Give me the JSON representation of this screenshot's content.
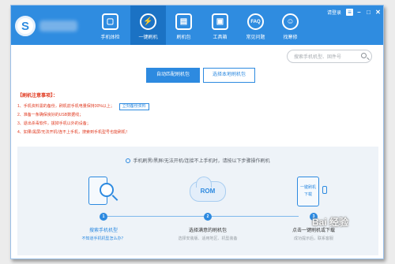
{
  "window": {
    "user_label": "请登录",
    "accent": "#2f8ce0",
    "controls": [
      "menu-icon",
      "minimize-icon",
      "maximize-icon",
      "close-icon"
    ]
  },
  "nav": [
    {
      "label": "手机体检",
      "icon": "phone-check-icon",
      "glyph": "▢"
    },
    {
      "label": "一键刷机",
      "icon": "flash-icon",
      "glyph": "⚡"
    },
    {
      "label": "刷机包",
      "icon": "package-icon",
      "glyph": "▤"
    },
    {
      "label": "工具箱",
      "icon": "toolbox-icon",
      "glyph": "▣"
    },
    {
      "label": "常见问题",
      "icon": "faq-icon",
      "glyph": "FAQ"
    },
    {
      "label": "找寒修",
      "icon": "repair-person-icon",
      "glyph": "☺"
    }
  ],
  "search": {
    "placeholder": "搜索手机机型、固件号"
  },
  "actions": {
    "auto_match": "自动匹配刷机包",
    "local_package": "选择本地刷机包"
  },
  "notes": {
    "title": "【刷机注意事项】：",
    "items": [
      "1、手机资料需的备份，刷机前手机电量保持30%以上；",
      "2、准备一条确保良好的USB数据线；",
      "3、退出杀毒软件，拔掉手机以外的设备；",
      "4、如果/黑屏/无法开机/连不上手机，搜索到手机型号也能刷机！"
    ],
    "backup_button": "立刻备份资料"
  },
  "guide": {
    "hint": "手机刷黑/黑屏/无法开机/连接不上手机时，请按以下步骤操作刷机",
    "steps": [
      {
        "num": "1",
        "title": "搜索手机机型",
        "sub": "不知道手机机型怎么办？",
        "icon": "phone-search-icon"
      },
      {
        "num": "2",
        "title": "选择满意的刷机包",
        "sub": "选择安装版、适用地区、机型装备",
        "icon": "rom-cloud-icon",
        "rom": "ROM"
      },
      {
        "num": "3",
        "title": "点击一键刷机或下载",
        "sub": "成功提示后，联系客服",
        "icon": "phone-download-icon",
        "phone_label_1": "一键刷机",
        "phone_label_2": "下载"
      }
    ]
  },
  "watermark": "Bai 经验"
}
